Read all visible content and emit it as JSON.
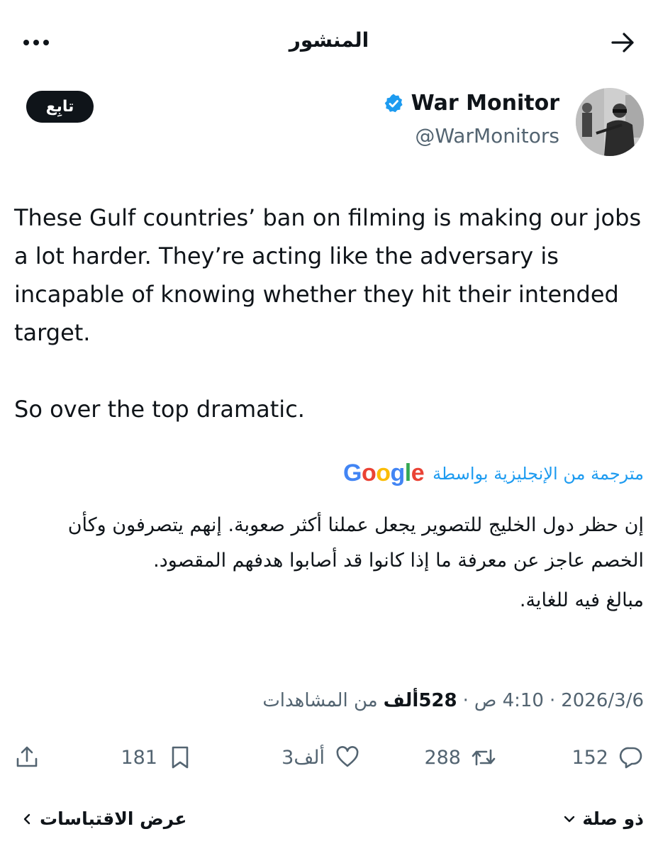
{
  "header": {
    "title": "المنشور",
    "back_icon": "arrow-right-icon",
    "more_icon": "more-horizontal-icon"
  },
  "author": {
    "display_name": "War Monitor",
    "handle": "@WarMonitors",
    "verified": true,
    "verified_color": "#1d9bf0",
    "follow_label": "تابِع"
  },
  "tweet": {
    "text": "These Gulf countries’ ban on filming is making our jobs a lot harder. They’re acting like the adversary is incapable of knowing whether they hit their intended target.\n\nSo over the top dramatic."
  },
  "translation": {
    "label": "مترجمة من الإنجليزية بواسطة",
    "provider": "Google",
    "paragraph1": "إن حظر دول الخليج للتصوير يجعل عملنا أكثر صعوبة. إنهم يتصرفون وكأن الخصم عاجز عن معرفة ما إذا كانوا قد أصابوا هدفهم المقصود.",
    "paragraph2": "مبالغ فيه للغاية."
  },
  "meta": {
    "date": "2026/3/6",
    "separator1": "·",
    "time": "4:10 ص",
    "separator2": "·",
    "views_count": "528ألف",
    "views_label": "من المشاهدات"
  },
  "actions": {
    "replies": "152",
    "retweets": "288",
    "likes": "3ألف",
    "bookmarks": "181"
  },
  "footer": {
    "related_label": "ذو صلة",
    "quotes_label": "عرض الاقتباسات"
  },
  "colors": {
    "accent": "#1d9bf0",
    "text_primary": "#0f1419",
    "text_secondary": "#536471"
  }
}
